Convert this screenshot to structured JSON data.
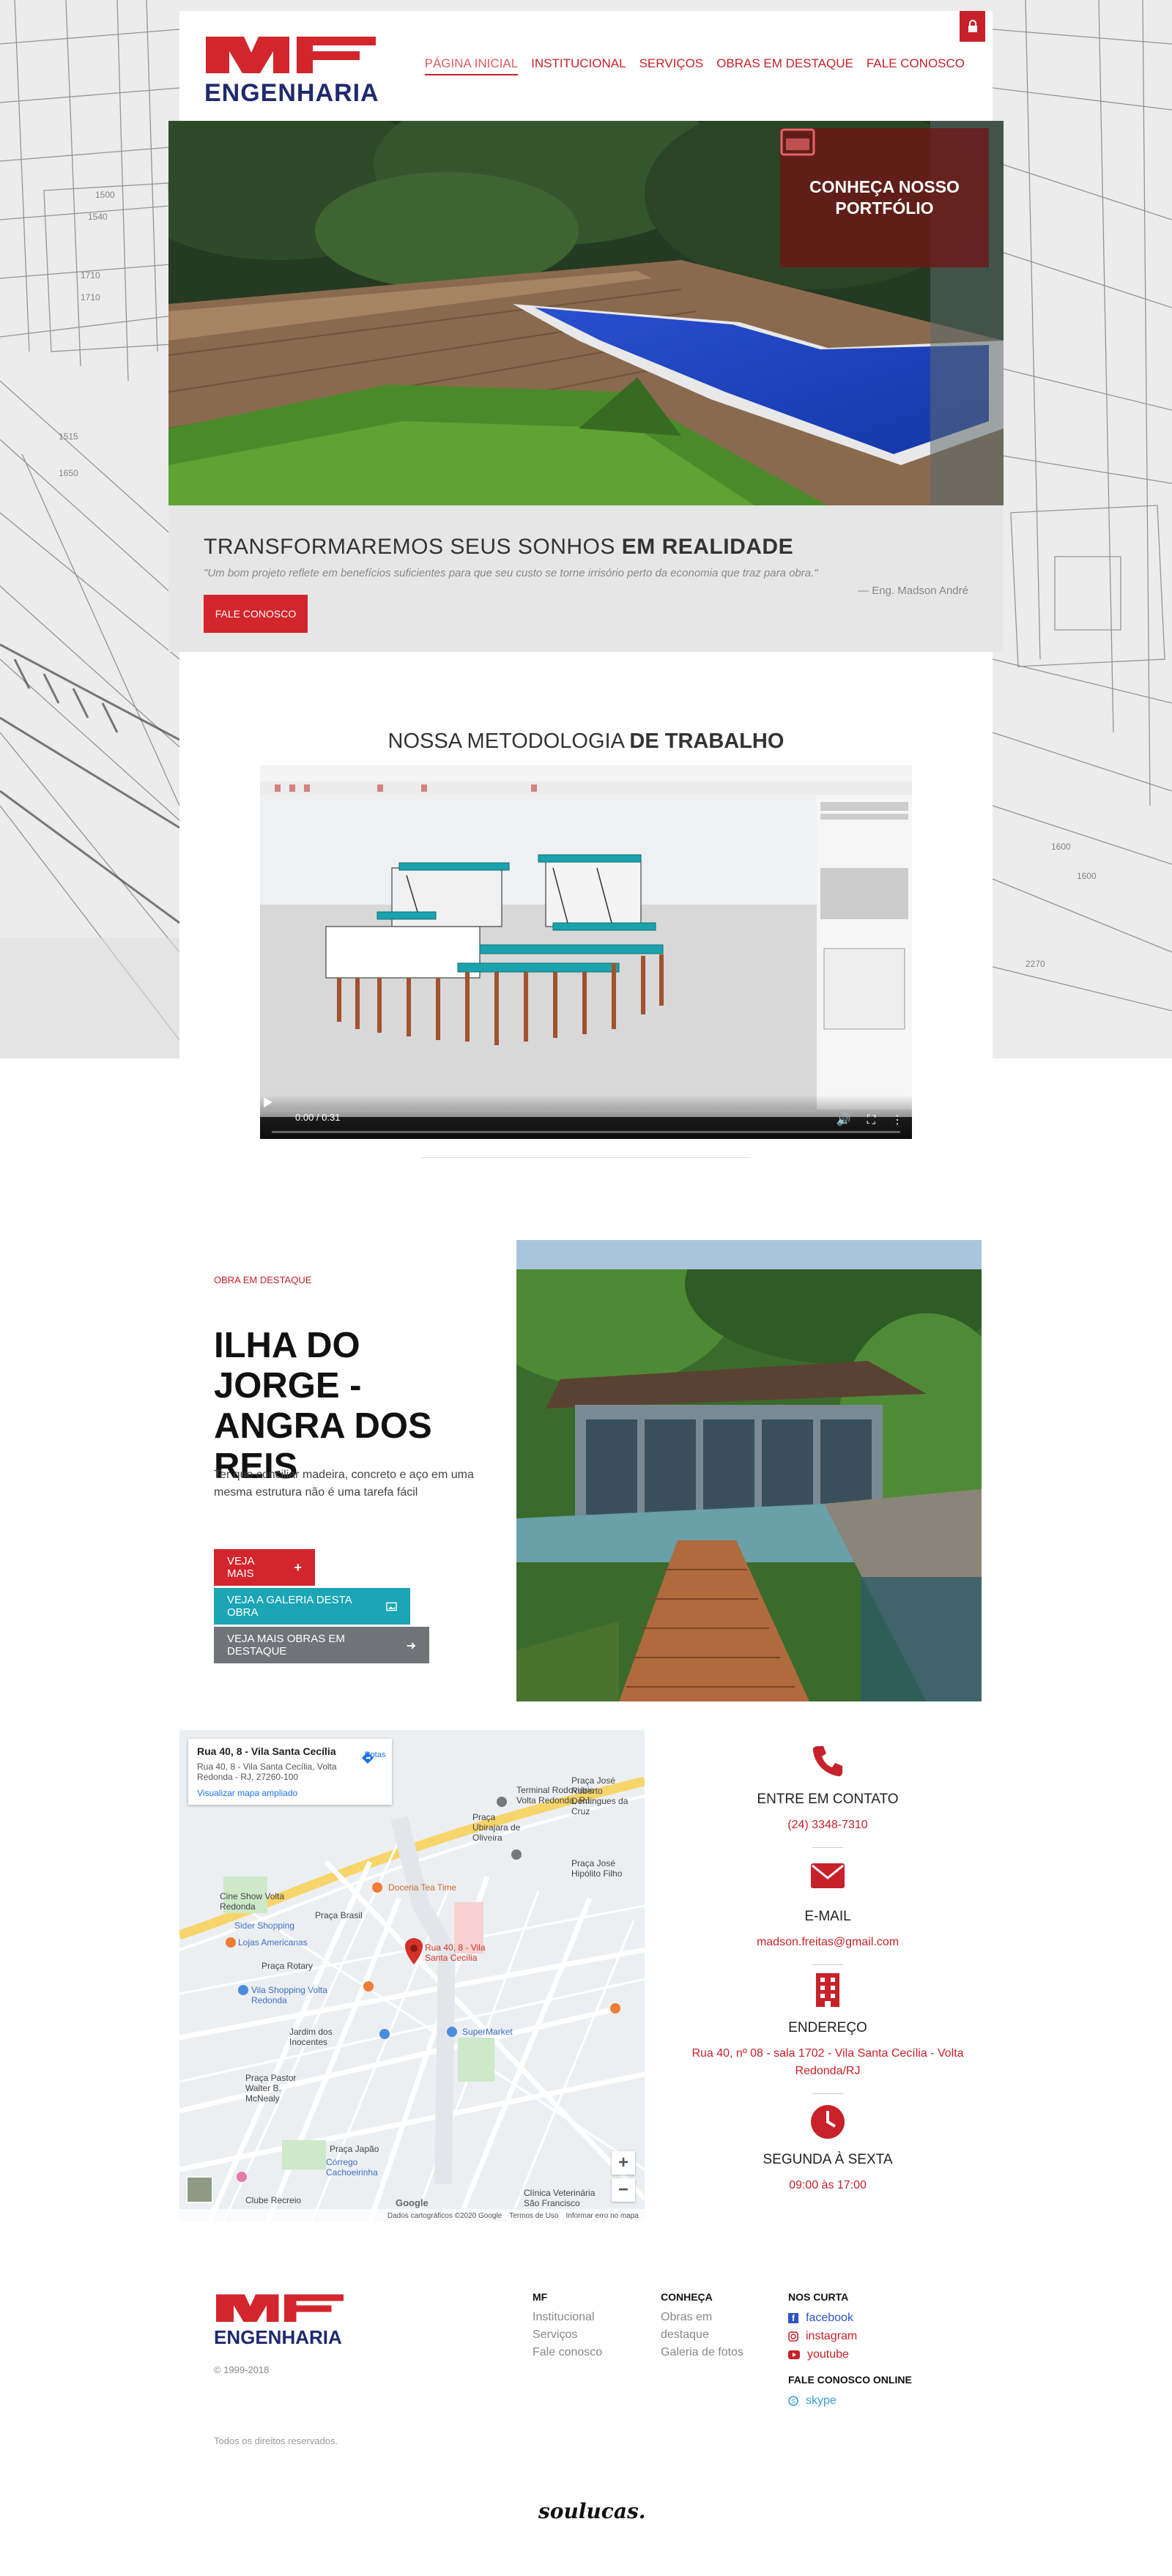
{
  "header": {
    "brand": "ENGENHARIA",
    "nav": [
      {
        "label": "PÁGINA INICIAL"
      },
      {
        "label": "INSTITUCIONAL"
      },
      {
        "label": "SERVIÇOS"
      },
      {
        "label": "OBRAS EM DESTAQUE"
      },
      {
        "label": "FALE CONOSCO"
      }
    ]
  },
  "hero": {
    "portfolio_label": "CONHEÇA NOSSO PORTFÓLIO"
  },
  "tagline": {
    "title_main": "TRANSFORMAREMOS SEUS SONHOS ",
    "title_bold": "EM REALIDADE",
    "quote": "\"Um bom projeto reflete em benefícios suficientes para que seu custo se torne irrisório perto da economia que traz para obra.\"",
    "author": "— Eng. Madson André",
    "button": "FALE CONOSCO"
  },
  "methodology": {
    "title_main": "NOSSA METODOLOGIA ",
    "title_bold": "DE TRABALHO",
    "video_time": "0:00 / 0:31"
  },
  "featured": {
    "small_label": "OBRA EM DESTAQUE",
    "title": "ILHA DO JORGE - ANGRA DOS REIS",
    "description": "Ter que conciliar madeira, concreto e aço em uma mesma estrutura não é uma tarefa fácil",
    "buttons": [
      "VEJA MAIS",
      "VEJA A GALERIA DESTA OBRA",
      "VEJA MAIS OBRAS EM DESTAQUE"
    ]
  },
  "map": {
    "title": "Rua 40, 8 - Vila Santa Cecília",
    "address": "Rua 40, 8 - Vila Santa Cecília, Volta Redonda - RJ, 27260-100",
    "link": "Visualizar mapa ampliado",
    "route": "Rotas",
    "pin_label": "Rua 40, 8 - Vila Santa Cecília",
    "labels": [
      "Terminal Rodoviário Volta Redonda, RJ",
      "Praça José Roberto Domingues da Cruz",
      "Cine Show Volta Redonda",
      "Sider Shopping",
      "Lojas Americanas",
      "Doceria Tea Time",
      "Praça Brasil",
      "Praça Rotary",
      "Vila Shopping Volta Redonda",
      "SuperMarket",
      "Jardim dos Inocentes",
      "Praça Pastor Walter B. McNealy",
      "Praça Japão",
      "Córrego Cachoeirinha",
      "Clube Recreio",
      "Clínica Veterinária São Francisco",
      "Praça José Hipólito Filho",
      "Praça Ubirajara de Oliveira"
    ],
    "footer": [
      "Dados cartográficos ©2020 Google",
      "Termos de Uso",
      "Informar erro no mapa"
    ],
    "google": "Google"
  },
  "contact": [
    {
      "icon": "phone-icon",
      "title": "ENTRE EM CONTATO",
      "value": "(24) 3348-7310"
    },
    {
      "icon": "envelope-icon",
      "title": "E-MAIL",
      "value": "madson.freitas@gmail.com"
    },
    {
      "icon": "building-icon",
      "title": "ENDEREÇO",
      "value": "Rua 40, nº 08 - sala 1702 - Vila Santa Cecília - Volta Redonda/RJ"
    },
    {
      "icon": "clock-icon",
      "title": "SEGUNDA À SEXTA",
      "value": "09:00 às 17:00"
    }
  ],
  "footer": {
    "brand": "ENGENHARIA",
    "copyright": "© 1999-2018",
    "col_mf": {
      "title": "MF",
      "links": [
        "Institucional",
        "Serviços",
        "Fale conosco"
      ]
    },
    "col_conheca": {
      "title": "CONHEÇA",
      "links": [
        "Obras em destaque",
        "Galeria de fotos"
      ]
    },
    "col_social": {
      "title": "NOS CURTA",
      "links": [
        "facebook",
        "instagram",
        "youtube"
      ]
    },
    "online_title": "FALE CONOSCO ONLINE",
    "skype": "skype",
    "rights": "Todos os direitos reservados.",
    "dev_brand": "soulucas."
  },
  "colors": {
    "accent": "#c8212a",
    "navy": "#1f2a6e",
    "teal": "#1ba5b5",
    "gray_button": "#707479"
  }
}
